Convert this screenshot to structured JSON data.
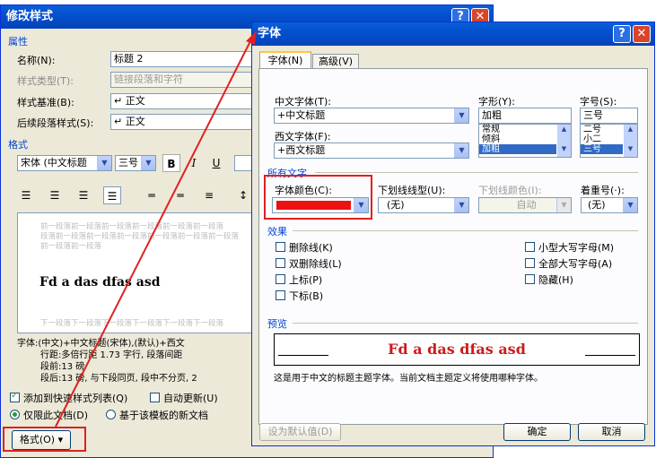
{
  "modify_style": {
    "title": "修改样式",
    "properties_header": "属性",
    "name_label": "名称(N):",
    "name_value": "标题 2",
    "style_type_label": "样式类型(T):",
    "style_type_value": "链接段落和字符",
    "based_on_label": "样式基准(B):",
    "based_on_value": "↵ 正文",
    "following_label": "后续段落样式(S):",
    "following_value": "↵ 正文",
    "format_header": "格式",
    "font_value": "宋体 (中文标题",
    "size_value": "三号",
    "bold": "B",
    "italic": "I",
    "underline": "U",
    "preview_before": [
      "前一段落前一段落前一段落前一段落前一段落前一段落",
      "段落前一段落前一段落前一段落前一段落前一段落前一段落",
      "前一段落前一段落"
    ],
    "preview_sample": "Fd a das dfas asd",
    "preview_after": "下一段落下一段落下一段落下一段落下一段落下一段落",
    "description": [
      "字体:(中文)+中文标题(宋体),(默认)+西文",
      "行距:多倍行距 1.73 字行, 段落间距",
      "段前:13 磅",
      "段后:13 磅, 与下段同页, 段中不分页, 2"
    ],
    "add_to_quick_label": "添加到快速样式列表(Q)",
    "auto_update_label": "自动更新(U)",
    "only_doc_label": "仅限此文档(D)",
    "new_docs_label": "基于该模板的新文档",
    "format_button": "格式(O) ▾"
  },
  "font_dialog": {
    "title": "字体",
    "help": "?",
    "close": "✕",
    "tabs": [
      "字体(N)",
      "高级(V)"
    ],
    "asian_font_label": "中文字体(T):",
    "asian_font_value": "+中文标题",
    "latin_font_label": "西文字体(F):",
    "latin_font_value": "+西文标题",
    "style_label": "字形(Y):",
    "style_value": "加粗",
    "style_options": [
      "常规",
      "倾斜",
      "加粗"
    ],
    "size_label": "字号(S):",
    "size_value": "三号",
    "size_options": [
      "二号",
      "小二",
      "三号"
    ],
    "all_text_header": "所有文字",
    "color_label": "字体颜色(C):",
    "color_value": "#ee1111",
    "underline_style_label": "下划线线型(U):",
    "underline_style_value": "(无)",
    "underline_color_label": "下划线颜色(I):",
    "underline_color_value": "自动",
    "emphasis_label": "着重号(·):",
    "emphasis_value": "(无)",
    "effects_header": "效果",
    "effects_left": [
      "删除线(K)",
      "双删除线(L)",
      "上标(P)",
      "下标(B)"
    ],
    "effects_right": [
      "小型大写字母(M)",
      "全部大写字母(A)",
      "隐藏(H)"
    ],
    "preview_header": "预览",
    "preview_text": "Fd a das dfas asd",
    "preview_note": "这是用于中文的标题主题字体。当前文档主题定义将使用哪种字体。",
    "set_default": "设为默认值(D)",
    "ok": "确定",
    "cancel": "取消"
  },
  "colors": {
    "accent_red": "#e02020",
    "title_blue": "#0450d0",
    "preview_red": "#cc1b1b"
  }
}
